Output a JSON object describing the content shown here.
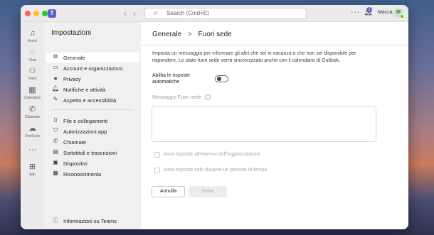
{
  "titlebar": {
    "search_placeholder": "Search (Cmd+E)",
    "more_label": "···",
    "notification_count": "1",
    "user_name": "Macca",
    "user_initials": "M"
  },
  "rail": {
    "items": [
      {
        "label": "Avvisi",
        "icon": "bell-icon"
      },
      {
        "label": "Chat",
        "icon": "chat-icon"
      },
      {
        "label": "Team",
        "icon": "team-icon"
      },
      {
        "label": "Calendario",
        "icon": "calendar-icon"
      },
      {
        "label": "Chiamate",
        "icon": "phone-icon"
      },
      {
        "label": "OneDrive",
        "icon": "cloud-icon"
      },
      {
        "label": "···",
        "icon": "more-icon"
      },
      {
        "label": "App",
        "icon": "apps-icon"
      }
    ]
  },
  "settings": {
    "title": "Impostazioni",
    "menu": [
      {
        "label": "Generale",
        "icon": "gear-icon",
        "active": true
      },
      {
        "label": "Account e organizzazioni",
        "icon": "account-icon"
      },
      {
        "label": "Privacy",
        "icon": "lock-icon"
      },
      {
        "label": "Notifiche e attività",
        "icon": "bell-icon"
      },
      {
        "label": "Aspetto e accessibilità",
        "icon": "appearance-icon"
      },
      {
        "label": "File e collegamenti",
        "icon": "file-icon"
      },
      {
        "label": "Autorizzazioni app",
        "icon": "shield-icon"
      },
      {
        "label": "Chiamate",
        "icon": "phone-icon"
      },
      {
        "label": "Sottotitoli e trascrizioni",
        "icon": "captions-icon"
      },
      {
        "label": "Dispositivi",
        "icon": "device-icon"
      },
      {
        "label": "Riconoscimento",
        "icon": "recognition-icon"
      }
    ],
    "footer": "Informazioni su Teams"
  },
  "main": {
    "breadcrumb_parent": "Generale",
    "breadcrumb_sep": ">",
    "breadcrumb_current": "Fuori sede",
    "description": "Imposta un messaggio per informare gli altri che sei in vacanza o che non sei disponibile per rispondere. Lo stato fuori sede verrà sincronizzato anche con il calendario di Outlook.",
    "toggle_label": "Abilita le risposte automatiche",
    "toggle_on": false,
    "message_label": "Messaggio Fuori sede",
    "message_value": "",
    "checkbox_external": "Invia risposte all'esterno dell'organizzazione",
    "checkbox_period": "Invia risposte solo durante un periodo di tempo",
    "cancel_label": "Annulla",
    "save_label": "Salva"
  },
  "colors": {
    "accent": "#5b5fc7",
    "presence": "#6bb700"
  }
}
